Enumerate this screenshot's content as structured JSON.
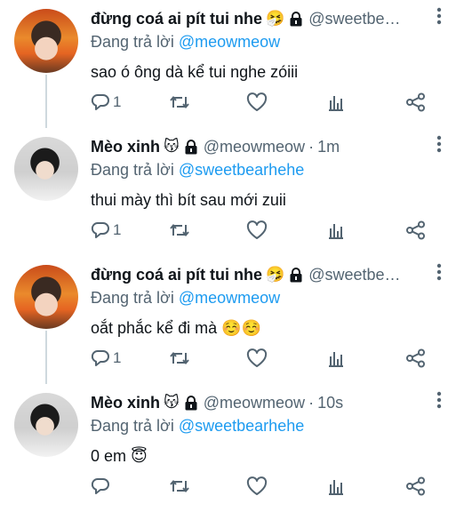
{
  "tweets": [
    {
      "author": "đừng coá ai pít tui nhe",
      "emoji": "🤧",
      "handle": "@sweetbe…",
      "time": "",
      "reply_prefix": "Đang trả lời",
      "reply_to": "@meowmeow",
      "text": "sao ó ông dà kể tui nghe zóiii",
      "reply_count": "1",
      "avatar": "orange"
    },
    {
      "author": "Mèo xinh",
      "emoji": "😽",
      "handle": "@meowmeow",
      "time": "1m",
      "reply_prefix": "Đang trả lời",
      "reply_to": "@sweetbearhehe",
      "text": "thui mày thì bít sau mới zuii",
      "reply_count": "1",
      "avatar": "dark"
    },
    {
      "author": "đừng coá ai pít tui nhe",
      "emoji": "🤧",
      "handle": "@sweetbe…",
      "time": "",
      "reply_prefix": "Đang trả lời",
      "reply_to": "@meowmeow",
      "text": "oắt phắc kể đi mà ☺️☺️",
      "reply_count": "1",
      "avatar": "orange"
    },
    {
      "author": "Mèo xinh",
      "emoji": "😽",
      "handle": "@meowmeow",
      "time": "10s",
      "reply_prefix": "Đang trả lời",
      "reply_to": "@sweetbearhehe",
      "text": "0 em 😇",
      "reply_count": "",
      "avatar": "dark"
    }
  ],
  "icons": {
    "lock": "lock-icon",
    "more": "more-vertical-icon",
    "reply": "reply-icon",
    "retweet": "retweet-icon",
    "like": "heart-icon",
    "stats": "stats-icon",
    "share": "share-icon"
  },
  "colors": {
    "text": "#0f1419",
    "muted": "#536471",
    "mention": "#1d9bf0",
    "thread_line": "#cfd9de"
  }
}
